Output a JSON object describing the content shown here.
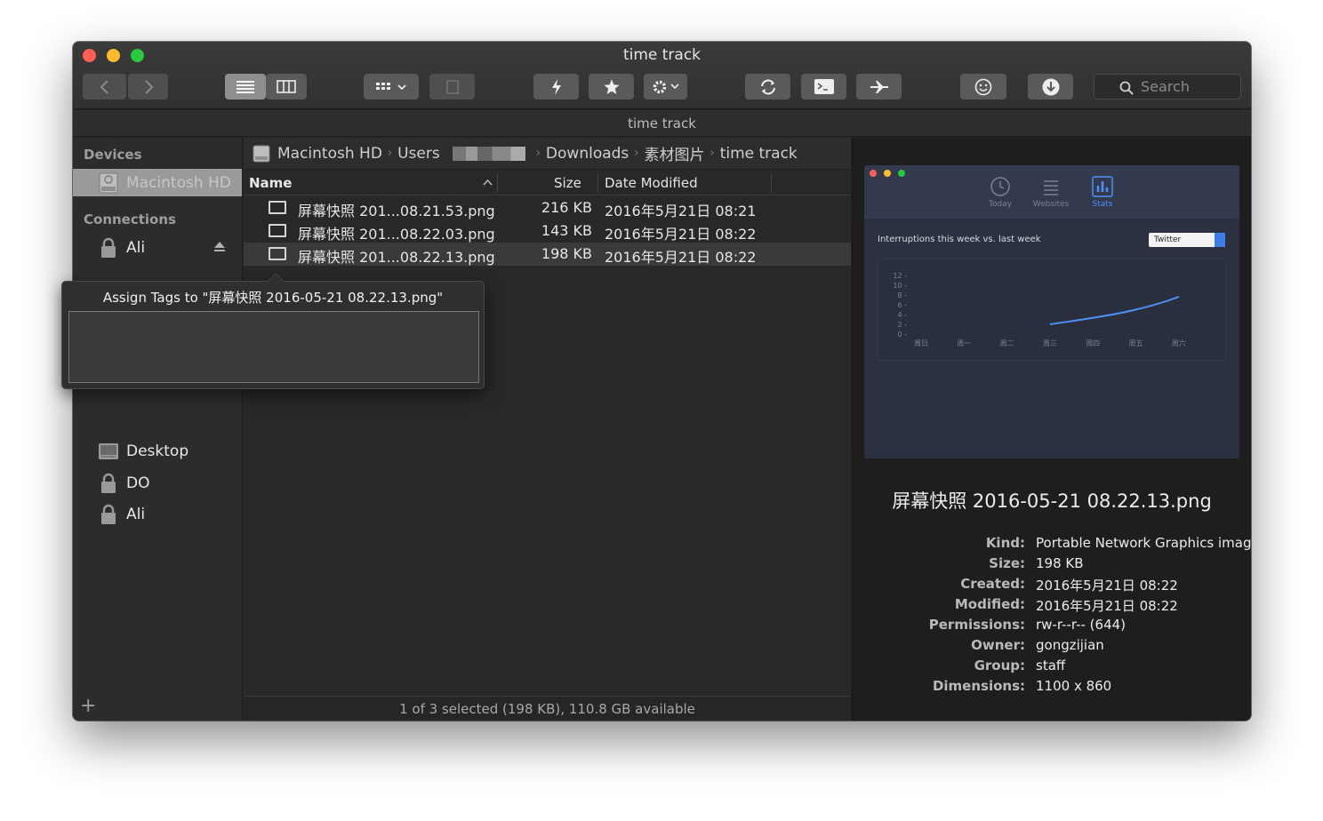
{
  "window": {
    "title": "time track",
    "path_title": "time track"
  },
  "toolbar": {
    "back_icon": "chevron-left-icon",
    "forward_icon": "chevron-right-icon",
    "list_view_icon": "list-view-icon",
    "column_view_icon": "column-view-icon",
    "group_icon": "grid-icon",
    "action_icon": "bolt-icon",
    "favorite_icon": "star-icon",
    "settings_icon": "gear-icon",
    "sync_icon": "refresh-icon",
    "terminal_icon": "terminal-icon",
    "airdrop_icon": "airplane-icon",
    "smile_icon": "smile-icon",
    "download_icon": "download-icon",
    "search_placeholder": "Search"
  },
  "sidebar": {
    "devices_heading": "Devices",
    "devices": [
      {
        "label": "Macintosh HD",
        "icon": "hard-drive-icon",
        "selected": true
      }
    ],
    "connections_heading": "Connections",
    "connections": [
      {
        "label": "Ali",
        "icon": "lock-icon"
      }
    ],
    "places": [
      {
        "label": "Desktop",
        "icon": "desktop-icon"
      },
      {
        "label": "DO",
        "icon": "lock-icon"
      },
      {
        "label": "Ali",
        "icon": "lock-icon"
      }
    ],
    "add_label": "+"
  },
  "breadcrumb": {
    "items": [
      "Macintosh HD",
      "Users",
      "Downloads",
      "素材图片",
      "time track"
    ]
  },
  "file_list": {
    "columns": {
      "name": "Name",
      "size": "Size",
      "date": "Date Modified"
    },
    "rows": [
      {
        "name": "屏幕快照 201...08.21.53.png",
        "size": "216 KB",
        "date": "2016年5月21日 08:21",
        "selected": false
      },
      {
        "name": "屏幕快照 201...08.22.03.png",
        "size": "143 KB",
        "date": "2016年5月21日 08:22",
        "selected": false
      },
      {
        "name": "屏幕快照 201...08.22.13.png",
        "size": "198 KB",
        "date": "2016年5月21日 08:22",
        "selected": true
      }
    ],
    "status": "1 of 3 selected (198 KB), 110.8 GB available"
  },
  "tag_popover": {
    "title": "Assign Tags to \"屏幕快照 2016-05-21 08.22.13.png\"",
    "value": ""
  },
  "preview": {
    "thumbnail": {
      "tabs": [
        "Today",
        "Websites",
        "Stats"
      ],
      "active_tab": "Stats",
      "label": "Interruptions this week vs. last week",
      "select_value": "Twitter",
      "y_ticks": [
        "12",
        "10",
        "8",
        "6",
        "4",
        "2",
        "0"
      ],
      "x_ticks": [
        "周日",
        "周一",
        "周二",
        "周三",
        "周四",
        "周五",
        "周六"
      ]
    },
    "filename": "屏幕快照 2016-05-21 08.22.13.png",
    "info": [
      {
        "k": "Kind:",
        "v": "Portable Network Graphics image"
      },
      {
        "k": "Size:",
        "v": "198 KB"
      },
      {
        "k": "Created:",
        "v": "2016年5月21日 08:22"
      },
      {
        "k": "Modified:",
        "v": "2016年5月21日 08:22"
      },
      {
        "k": "Permissions:",
        "v": "rw-r--r-- (644)"
      },
      {
        "k": "Owner:",
        "v": "gongzijian"
      },
      {
        "k": "Group:",
        "v": "staff"
      },
      {
        "k": "Dimensions:",
        "v": "1100 x 860"
      }
    ]
  },
  "colors": {
    "accent_blue": "#4f8ff7",
    "close": "#fd5f57",
    "minimize": "#fdbb2e",
    "maximize": "#28c840"
  }
}
